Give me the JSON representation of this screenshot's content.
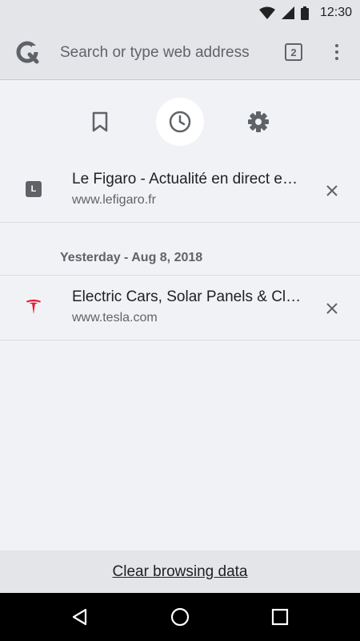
{
  "status_bar": {
    "time": "12:30"
  },
  "toolbar": {
    "address_placeholder": "Search or type web address",
    "tab_count": "2"
  },
  "panel_tabs": [
    {
      "name": "bookmarks",
      "active": false
    },
    {
      "name": "history",
      "active": true
    },
    {
      "name": "settings",
      "active": false
    }
  ],
  "history": {
    "items_today": [
      {
        "favicon_letter": "L",
        "title": "Le Figaro - Actualité en direct e…",
        "url": "www.lefigaro.fr"
      }
    ],
    "section_yesterday": "Yesterday - Aug 8, 2018",
    "items_yesterday": [
      {
        "favicon": "tesla-logo",
        "title": "Electric Cars, Solar Panels & Cl…",
        "url": "www.tesla.com"
      }
    ]
  },
  "clear_bar": {
    "label": "Clear browsing data"
  },
  "colors": {
    "tesla_red": "#e31937",
    "favicon_gray": "#5f6368",
    "active_tab_bg": "#ffffff"
  }
}
